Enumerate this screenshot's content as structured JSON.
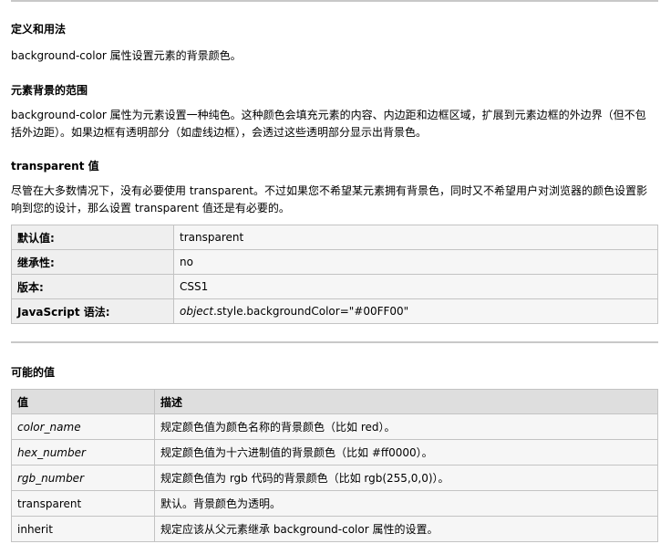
{
  "sections": {
    "definition": {
      "heading": "定义和用法",
      "text": "background-color 属性设置元素的背景颜色。"
    },
    "range": {
      "heading": "元素背景的范围",
      "text": "background-color 属性为元素设置一种纯色。这种颜色会填充元素的内容、内边距和边框区域，扩展到元素边框的外边界（但不包括外边距）。如果边框有透明部分（如虚线边框），会透过这些透明部分显示出背景色。"
    },
    "transparent": {
      "heading": "transparent 值",
      "text": "尽管在大多数情况下，没有必要使用 transparent。不过如果您不希望某元素拥有背景色，同时又不希望用户对浏览器的颜色设置影响到您的设计，那么设置 transparent 值还是有必要的。"
    }
  },
  "props_table": [
    {
      "key": "默认值:",
      "value": "transparent"
    },
    {
      "key": "继承性:",
      "value": "no"
    },
    {
      "key": "版本:",
      "value": "CSS1"
    },
    {
      "key": "JavaScript 语法:",
      "value_italic": "object",
      "value": ".style.backgroundColor=\"#00FF00\""
    }
  ],
  "values": {
    "heading": "可能的值",
    "headers": [
      "值",
      "描述"
    ],
    "rows": [
      {
        "value": "color_name",
        "desc": "规定颜色值为颜色名称的背景颜色（比如 red）。"
      },
      {
        "value": "hex_number",
        "desc": "规定颜色值为十六进制值的背景颜色（比如 #ff0000）。"
      },
      {
        "value": "rgb_number",
        "desc": "规定颜色值为 rgb 代码的背景颜色（比如 rgb(255,0,0)）。"
      },
      {
        "value": "transparent",
        "desc": "默认。背景颜色为透明。"
      },
      {
        "value": "inherit",
        "desc": "规定应该从父元素继承 background-color 属性的设置。"
      }
    ]
  }
}
